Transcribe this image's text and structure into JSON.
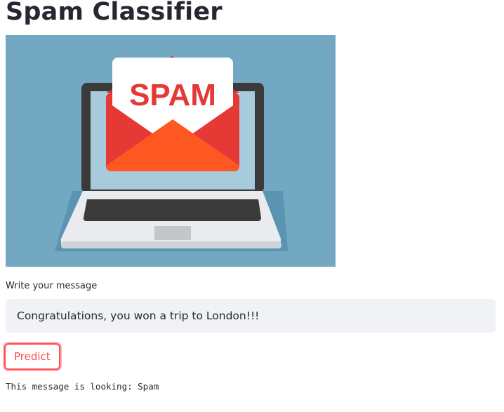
{
  "page": {
    "title": "Spam Classifier"
  },
  "hero_image": {
    "alt": "Laptop with envelope containing a SPAM letter",
    "letter_text": "SPAM",
    "colors": {
      "background": "#73a8c2",
      "envelope_red": "#e53935",
      "envelope_flap": "#ff5722",
      "letter_text": "#e53935",
      "laptop_frame": "#3a3a3a",
      "laptop_screen": "#a8cbdb",
      "laptop_base": "#eaebef"
    }
  },
  "message_input": {
    "label": "Write your message",
    "value": "Congratulations, you won a trip to London!!!"
  },
  "predict_button": {
    "label": "Predict"
  },
  "result": {
    "text": "This message is looking: Spam"
  },
  "colors": {
    "primary": "#ff4b4b",
    "text": "#262730",
    "input_background": "#f0f2f6"
  }
}
